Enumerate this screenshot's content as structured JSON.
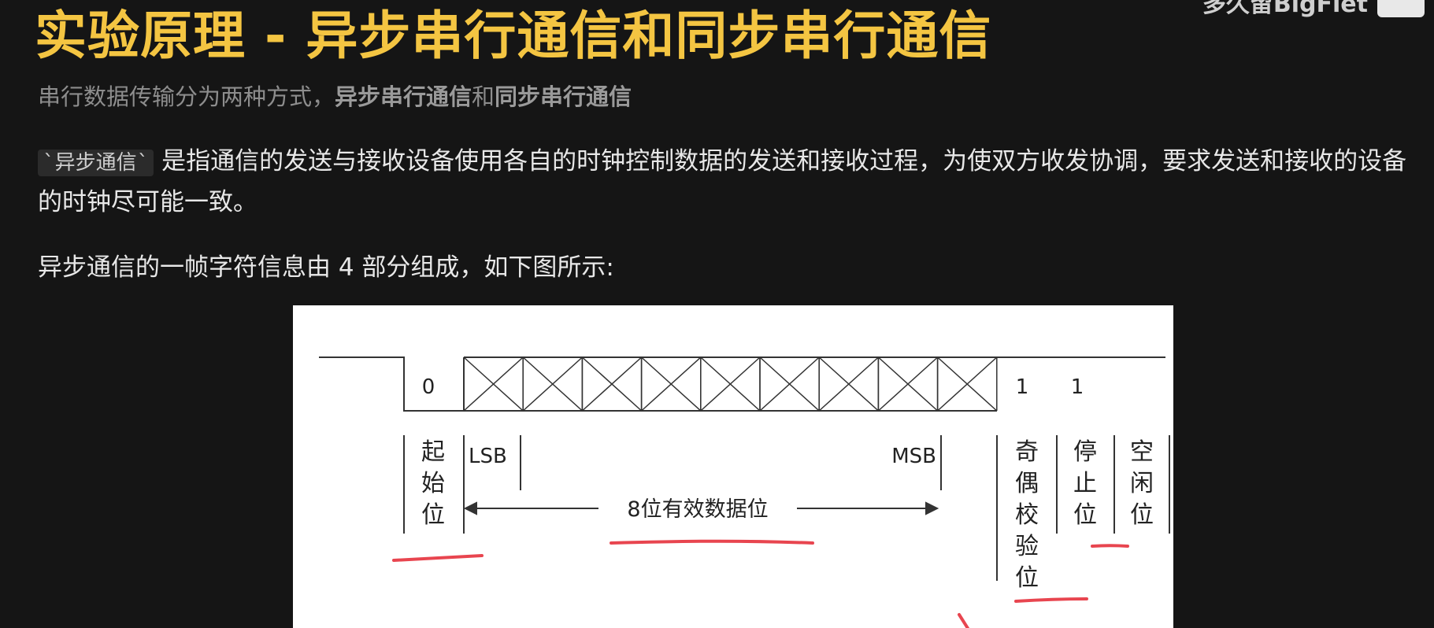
{
  "header": {
    "title": "实验原理 - 异步串行通信和同步串行通信",
    "watermark": "多久留BigFlet",
    "subtitle_prefix": "串行数据传输分为两种方式，",
    "subtitle_bold1": "异步串行通信",
    "subtitle_mid": "和",
    "subtitle_bold2": "同步串行通信"
  },
  "body": {
    "code_term": "`异步通信`",
    "paragraph1": "是指通信的发送与接收设备使用各自的时钟控制数据的发送和接收过程，为使双方收发协调，要求发送和接收的设备的时钟尽可能一致。",
    "paragraph2": "异步通信的一帧字符信息由 4 部分组成，如下图所示:"
  },
  "diagram": {
    "start_bit_value": "0",
    "stop_bit_value": "1",
    "idle_bit_value": "1",
    "lsb": "LSB",
    "msb": "MSB",
    "data_bits": "8位有效数据位",
    "start_bit_label": [
      "起",
      "始",
      "位"
    ],
    "parity_label": [
      "奇",
      "偶",
      "校",
      "验",
      "位"
    ],
    "stop_label": [
      "停",
      "止",
      "位"
    ],
    "idle_label": [
      "空",
      "闲",
      "位"
    ],
    "annotation_color": "#e8454f"
  }
}
